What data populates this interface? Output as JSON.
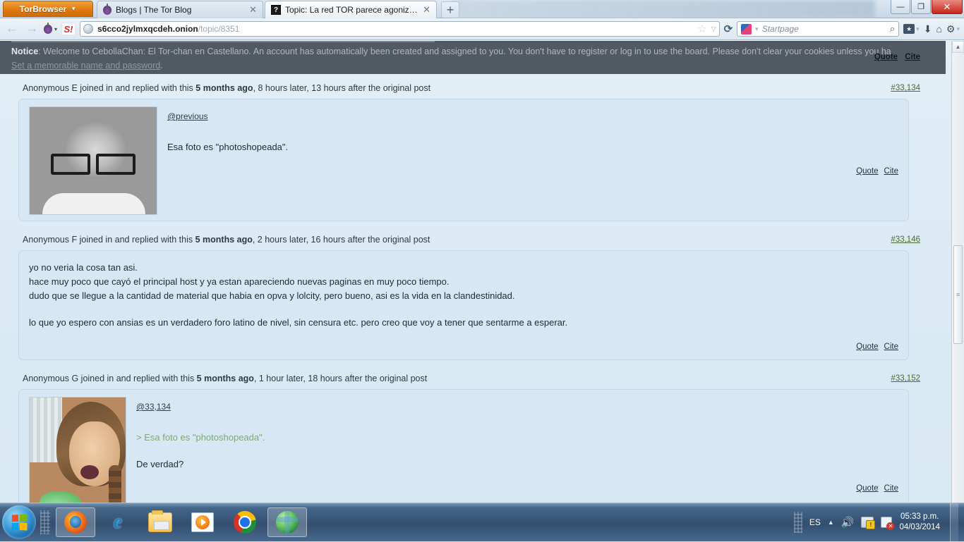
{
  "browser": {
    "tor_button_label": "TorBrowser",
    "tabs": [
      {
        "title": "Blogs | The Tor Blog",
        "icon": "onion-favicon",
        "active": false
      },
      {
        "title": "Topic: La red TOR parece agonizante ...",
        "icon": "dark-question-favicon",
        "active": true
      }
    ],
    "new_tab_label": "+",
    "window_controls": {
      "minimize": "—",
      "maximize": "❐",
      "close": "✕"
    },
    "nav": {
      "back": "←",
      "forward": "→",
      "onion_menu_caret": "▾",
      "slashdot_label": "S!"
    },
    "url": {
      "host": "s6cco2jylmxqcdeh.onion",
      "path": "/topic/8351"
    },
    "urlbar_icons": {
      "star": "☆",
      "caret": "▽",
      "reload": "⟳"
    },
    "search": {
      "engine": "Startpage",
      "placeholder": "Startpage",
      "magnifier": "⌕"
    },
    "toolbar_icons": {
      "bookmarks": "★",
      "bookmarks_caret": "▾",
      "download": "⬇",
      "home": "⌂",
      "settings": "⚙",
      "settings_caret": "▾"
    }
  },
  "notice": {
    "label": "Notice",
    "text_1": ": Welcome to CebollaChan: El Tor-chan en Castellano. An account has automatically been created and assigned to you. You don't have to register or log in to use the board. Please don't clear your cookies unless you ha",
    "link": "Set a memorable name and password",
    "trailing": "."
  },
  "floating_actions": {
    "quote": "Quote",
    "cite": "Cite"
  },
  "posts": [
    {
      "meta_prefix": "Anonymous E joined in and replied with this ",
      "meta_bold": "5 months ago",
      "meta_suffix": ", 8 hours later, 13 hours after the original post",
      "post_id": "#33,134",
      "has_image": true,
      "image_kind": "bw-girl-glasses-photo",
      "reply_link": "@previous",
      "lines": [
        {
          "text": "Esa foto es \"photoshopeada\".",
          "quoted": false
        }
      ],
      "actions": {
        "quote": "Quote",
        "cite": "Cite"
      }
    },
    {
      "meta_prefix": "Anonymous F joined in and replied with this ",
      "meta_bold": "5 months ago",
      "meta_suffix": ", 2 hours later, 16 hours after the original post",
      "post_id": "#33,146",
      "has_image": false,
      "reply_link": "",
      "lines": [
        {
          "text": "yo no veria la cosa tan asi.",
          "quoted": false
        },
        {
          "text": "hace muy poco que cayó el principal host y ya estan apareciendo nuevas paginas en muy poco tiempo.",
          "quoted": false
        },
        {
          "text": "dudo que se llegue a la cantidad de material que habia en opva y lolcity, pero bueno, asi es la vida en la clandestinidad.",
          "quoted": false
        },
        {
          "text": "",
          "quoted": false
        },
        {
          "text": "lo que yo espero con ansias es un verdadero foro latino de nivel, sin censura etc. pero creo que voy a tener que sentarme a esperar.",
          "quoted": false
        }
      ],
      "actions": {
        "quote": "Quote",
        "cite": "Cite"
      }
    },
    {
      "meta_prefix": "Anonymous G joined in and replied with this ",
      "meta_bold": "5 months ago",
      "meta_suffix": ", 1 hour later, 18 hours after the original post",
      "post_id": "#33,152",
      "has_image": true,
      "image_kind": "color-girl-outdoor-photo",
      "reply_link": "@33,134",
      "lines": [
        {
          "text": "> Esa foto es \"photoshopeada\".",
          "quoted": true
        },
        {
          "text": "",
          "quoted": false
        },
        {
          "text": "De verdad?",
          "quoted": false
        }
      ],
      "actions": {
        "quote": "Quote",
        "cite": "Cite"
      }
    }
  ],
  "scrollbar": {
    "up_arrow": "▲",
    "down_arrow": "▼",
    "grip": "≡"
  },
  "taskbar": {
    "start_label": "Start",
    "items": [
      {
        "name": "firefox",
        "running": true
      },
      {
        "name": "internet-explorer",
        "running": false
      },
      {
        "name": "windows-explorer",
        "running": false
      },
      {
        "name": "windows-media-player",
        "running": false
      },
      {
        "name": "google-chrome",
        "running": false
      },
      {
        "name": "tor-browser",
        "running": true
      }
    ],
    "tray": {
      "language": "ES",
      "show_hidden": "▲",
      "volume": "🔊",
      "time": "05:33 p.m.",
      "date": "04/03/2014"
    }
  },
  "colors": {
    "tor_orange": "#e07b10",
    "post_bg": "#d7e8f4",
    "page_bg": "#dcebf5",
    "notice_bg": "#3c464e",
    "post_id_green": "#4a6b2f",
    "quote_green": "#7fa878",
    "taskbar_blue": "#2a4667"
  }
}
